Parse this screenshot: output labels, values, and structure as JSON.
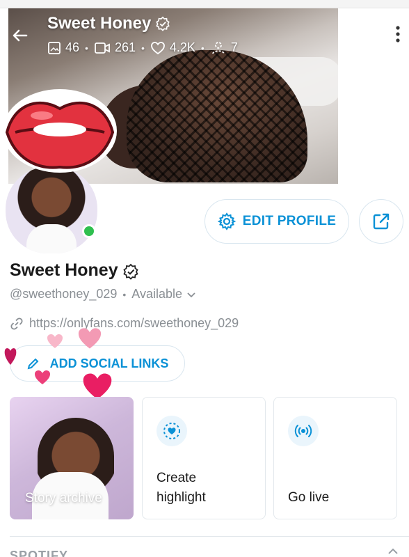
{
  "cover": {
    "name": "Sweet Honey",
    "stats": {
      "photos": "46",
      "videos": "261",
      "likes": "4.2K",
      "fans": "7"
    }
  },
  "profile": {
    "name": "Sweet Honey",
    "handle": "@sweethoney_029",
    "status": "Available",
    "link": "https://onlyfans.com/sweethoney_029"
  },
  "buttons": {
    "edit_profile": "EDIT PROFILE",
    "add_social_links": "ADD SOCIAL LINKS"
  },
  "cards": [
    {
      "label": "Story archive"
    },
    {
      "label_line1": "Create",
      "label_line2": "highlight"
    },
    {
      "label": "Go live"
    }
  ],
  "section": {
    "title": "SPOTIFY"
  },
  "colors": {
    "accent": "#0a91d6",
    "online": "#2fbf4f",
    "muted_text": "#8a8f94"
  },
  "icons": {
    "back": "arrow-left-icon",
    "photo": "image-icon",
    "video": "video-icon",
    "like": "heart-icon",
    "fans": "user-icon",
    "menu": "kebab-icon",
    "verified": "verified-icon",
    "edit": "gear-icon",
    "share": "share-icon",
    "link": "link-icon",
    "pencil": "pencil-icon",
    "highlight": "highlight-icon",
    "live": "broadcast-icon"
  }
}
